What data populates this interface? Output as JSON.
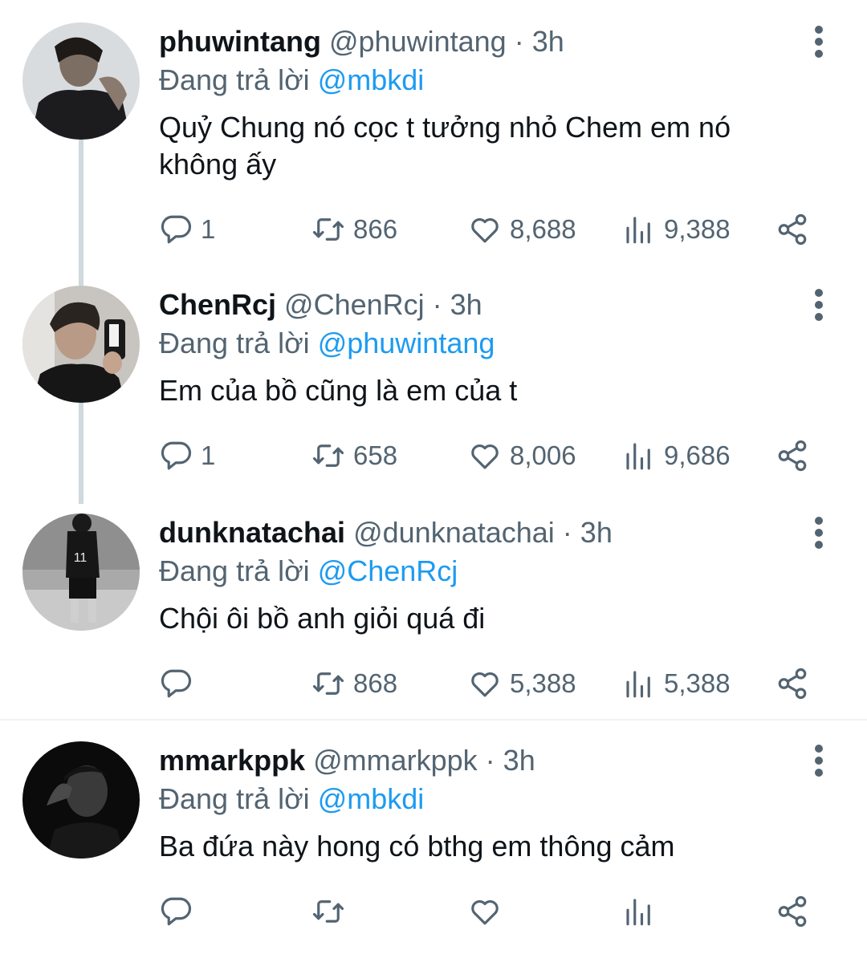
{
  "tweets": [
    {
      "name": "phuwintang",
      "handle": "@phuwintang",
      "time": "3h",
      "replying_prefix": "Đang trả lời ",
      "replying_to": "@mbkdi",
      "text": "Quỷ Chung nó cọc t tưởng nhỏ Chem em nó không ấy",
      "replies": "1",
      "retweets": "866",
      "likes": "8,688",
      "views": "9,388"
    },
    {
      "name": "ChenRcj",
      "handle": "@ChenRcj",
      "time": "3h",
      "replying_prefix": "Đang trả lời ",
      "replying_to": "@phuwintang",
      "text": "Em của bồ cũng là em của t",
      "replies": "1",
      "retweets": "658",
      "likes": "8,006",
      "views": "9,686"
    },
    {
      "name": "dunknatachai",
      "handle": "@dunknatachai",
      "time": "3h",
      "replying_prefix": "Đang trả lời ",
      "replying_to": "@ChenRcj",
      "text": "Chội ôi bồ anh giỏi quá đi",
      "replies": "",
      "retweets": "868",
      "likes": "5,388",
      "views": "5,388"
    },
    {
      "name": "mmarkppk",
      "handle": "@mmarkppk",
      "time": "3h",
      "replying_prefix": "Đang trả lời ",
      "replying_to": "@mbkdi",
      "text": "Ba đứa này hong có bthg em thông cảm",
      "replies": "",
      "retweets": "",
      "likes": "",
      "views": ""
    }
  ],
  "separator": " · ",
  "icons": {
    "reply": "reply-icon",
    "retweet": "retweet-icon",
    "like": "heart-icon",
    "views": "views-icon",
    "share": "share-icon",
    "more": "more-options-icon"
  },
  "colors": {
    "text": "#0f1419",
    "secondary": "#536471",
    "mention": "#1d9bf0",
    "thread_line": "#cfd9de"
  }
}
